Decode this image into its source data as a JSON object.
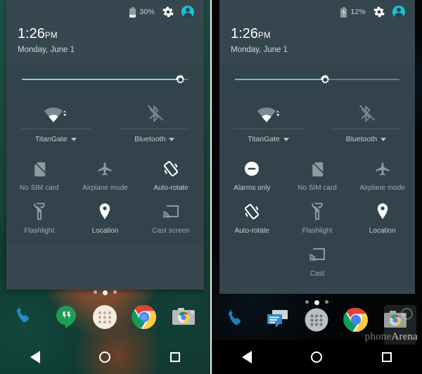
{
  "left_phone": {
    "status_bar": {
      "battery_percent": "30%",
      "battery_icon": "battery-icon",
      "charging": false,
      "settings_icon": "gear-icon",
      "avatar_icon": "user-avatar-icon",
      "accent_color": "#19c3d8"
    },
    "clock": {
      "time": "1:26",
      "ampm": "PM",
      "date": "Monday, June 1"
    },
    "brightness": {
      "label": "brightness-slider",
      "value": 95,
      "fill_color": "#80d6cf",
      "thumb_icon": "brightness-sun-icon"
    },
    "connectivity": [
      {
        "icon": "wifi-icon",
        "label": "TitanGate",
        "state": "on",
        "caret": "chevron-down-icon"
      },
      {
        "icon": "bluetooth-off-icon",
        "label": "Bluetooth",
        "state": "off",
        "caret": "chevron-down-icon"
      }
    ],
    "tiles": [
      {
        "icon": "no-sim-card-icon",
        "label": "No SIM card",
        "state": "off"
      },
      {
        "icon": "airplane-mode-off-icon",
        "label": "Airplane mode",
        "state": "off"
      },
      {
        "icon": "auto-rotate-icon",
        "label": "Auto-rotate",
        "state": "on"
      },
      {
        "icon": "flashlight-off-icon",
        "label": "Flashlight",
        "state": "off"
      },
      {
        "icon": "location-icon",
        "label": "Location",
        "state": "on"
      },
      {
        "icon": "cast-screen-icon",
        "label": "Cast screen",
        "state": "off"
      }
    ],
    "page_dots": {
      "count": 3,
      "active_index": 1
    },
    "dock": [
      {
        "icon": "phone-dialer-icon",
        "label": "Phone"
      },
      {
        "icon": "hangouts-icon",
        "label": "Hangouts"
      },
      {
        "icon": "app-drawer-icon",
        "label": "Apps"
      },
      {
        "icon": "chrome-icon",
        "label": "Chrome"
      },
      {
        "icon": "camera-icon",
        "label": "Camera"
      }
    ],
    "nav_bar": [
      {
        "icon": "back-icon",
        "label": "Back"
      },
      {
        "icon": "home-icon",
        "label": "Home"
      },
      {
        "icon": "recents-icon",
        "label": "Recents"
      }
    ]
  },
  "right_phone": {
    "status_bar": {
      "battery_percent": "12%",
      "battery_icon": "battery-charging-icon",
      "charging": true,
      "settings_icon": "gear-icon",
      "avatar_icon": "user-avatar-icon",
      "accent_color": "#19c3d8"
    },
    "clock": {
      "time": "1:26",
      "ampm": "PM",
      "date": "Monday, June 1"
    },
    "brightness": {
      "label": "brightness-slider",
      "value": 55,
      "fill_color": "#5cc8c0",
      "thumb_icon": "brightness-sun-icon"
    },
    "connectivity": [
      {
        "icon": "wifi-icon",
        "label": "TitanGate",
        "state": "on",
        "caret": "chevron-down-icon"
      },
      {
        "icon": "bluetooth-off-icon",
        "label": "Bluetooth",
        "state": "off",
        "caret": "chevron-down-icon"
      }
    ],
    "tiles": [
      {
        "icon": "alarms-only-icon",
        "label": "Alarms only",
        "state": "on"
      },
      {
        "icon": "no-sim-card-icon",
        "label": "No SIM card",
        "state": "off"
      },
      {
        "icon": "airplane-mode-off-icon",
        "label": "Airplane mode",
        "state": "off"
      },
      {
        "icon": "auto-rotate-icon",
        "label": "Auto-rotate",
        "state": "on"
      },
      {
        "icon": "flashlight-off-icon",
        "label": "Flashlight",
        "state": "off"
      },
      {
        "icon": "location-icon",
        "label": "Location",
        "state": "on"
      },
      {
        "icon": "cast-icon",
        "label": "Cast",
        "state": "off"
      }
    ],
    "page_dots": {
      "count": 3,
      "active_index": 1
    },
    "dock": [
      {
        "icon": "phone-dialer-icon",
        "label": "Phone"
      },
      {
        "icon": "messaging-icon",
        "label": "Messenger"
      },
      {
        "icon": "app-drawer-icon",
        "label": "Apps"
      },
      {
        "icon": "chrome-icon",
        "label": "Chrome"
      },
      {
        "icon": "camera-icon",
        "label": "Camera"
      }
    ],
    "nav_bar": [
      {
        "icon": "back-icon",
        "label": "Back"
      },
      {
        "icon": "home-icon",
        "label": "Home"
      },
      {
        "icon": "recents-icon",
        "label": "Recents"
      }
    ],
    "watermark": {
      "thin": "phone",
      "bold": "Arena"
    }
  }
}
